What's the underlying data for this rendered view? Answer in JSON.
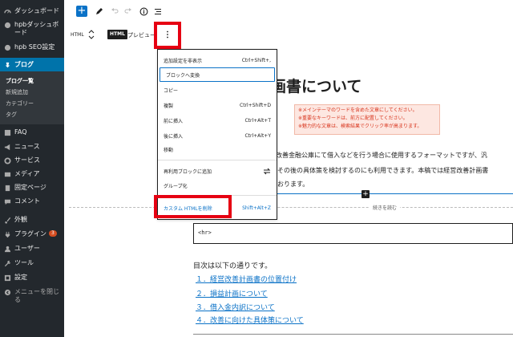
{
  "sidebar": {
    "items": [
      {
        "label": "ダッシュボード",
        "icon": "dashboard-icon"
      },
      {
        "label": "hpbダッシュボード",
        "icon": "hpb-icon"
      },
      {
        "label": "hpb SEO設定",
        "icon": "hpb-seo-icon"
      },
      {
        "label": "ブログ",
        "icon": "pin-icon"
      },
      {
        "label": "FAQ",
        "icon": "faq-icon"
      },
      {
        "label": "ニュース",
        "icon": "megaphone-icon"
      },
      {
        "label": "サービス",
        "icon": "gear-icon"
      },
      {
        "label": "メディア",
        "icon": "media-icon"
      },
      {
        "label": "固定ページ",
        "icon": "page-icon"
      },
      {
        "label": "コメント",
        "icon": "comment-icon"
      },
      {
        "label": "外観",
        "icon": "brush-icon"
      },
      {
        "label": "プラグイン",
        "icon": "plugin-icon",
        "badge": "3"
      },
      {
        "label": "ユーザー",
        "icon": "user-icon"
      },
      {
        "label": "ツール",
        "icon": "wrench-icon"
      },
      {
        "label": "設定",
        "icon": "settings-icon"
      },
      {
        "label": "メニューを閉じる",
        "icon": "collapse-icon"
      }
    ],
    "blog_submenu": [
      "ブログ一覧",
      "新規追加",
      "カテゴリー",
      "タグ"
    ]
  },
  "toolbar": {
    "block_type_label": "HTML",
    "html_chip": "HTML",
    "preview_label": "プレビュー"
  },
  "menu": {
    "items": [
      {
        "label": "追加設定を非表示",
        "shortcut": "Ctrl+Shift+,"
      },
      {
        "label": "ブロックへ変換",
        "shortcut": ""
      },
      {
        "label": "コピー",
        "shortcut": ""
      },
      {
        "label": "複製",
        "shortcut": "Ctrl+Shift+D"
      },
      {
        "label": "前に挿入",
        "shortcut": "Ctrl+Alt+T"
      },
      {
        "label": "後に挿入",
        "shortcut": "Ctrl+Alt+Y"
      },
      {
        "label": "移動",
        "shortcut": ""
      },
      {
        "label": "再利用ブロックに追加",
        "shortcut": ""
      },
      {
        "label": "グループ化",
        "shortcut": ""
      },
      {
        "label": "カスタム HTMLを削除",
        "shortcut": "Shift+Alt+Z"
      }
    ]
  },
  "content": {
    "title_fragment": "画書について",
    "notes": [
      "※メインテーマのワードを含めた文章にしてください。",
      "※重要なキーワードは、前方に配置してください。",
      "※魅力的な文章は、検索結果でクリック率が高まります。"
    ],
    "body_lines": [
      "改善金融公庫にて借入などを行う場合に使用するフォーマットですが、汎",
      "その後の具体策を検討するのにも利用できます。本稿では経営改善計画書",
      "おります。"
    ],
    "read_more": "続きを読む",
    "hr_code": "<hr>",
    "toc_intro": "目次は以下の通りです。",
    "toc_links": [
      "１．経営改善計画書の位置付け",
      "２．損益計画について",
      "３．借入金内訳について",
      "４．改善に向けた具体策について"
    ]
  },
  "colors": {
    "sidebar_bg": "#23282d",
    "accent": "#0073aa",
    "highlight": "#e60012",
    "link": "#0b72c7"
  }
}
